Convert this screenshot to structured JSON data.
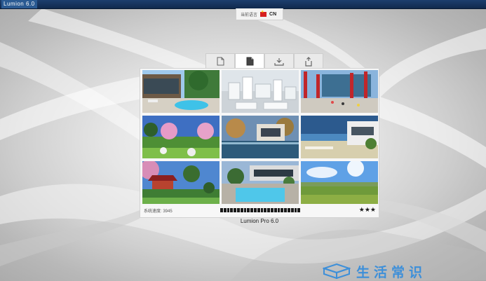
{
  "window": {
    "title": "Lumion 6.0"
  },
  "language": {
    "label": "当前语言",
    "code": "CN"
  },
  "tabs": [
    {
      "icon": "new-file-icon",
      "active": false
    },
    {
      "icon": "open-file-icon",
      "active": true
    },
    {
      "icon": "download-icon",
      "active": false
    },
    {
      "icon": "import-icon",
      "active": false
    }
  ],
  "gallery": [
    {
      "name": "modern-house-pool-scene"
    },
    {
      "name": "white-city-model-scene"
    },
    {
      "name": "red-pillars-plaza-scene"
    },
    {
      "name": "blossom-trees-river-scene"
    },
    {
      "name": "house-pond-autumn-scene"
    },
    {
      "name": "seaside-villa-scene"
    },
    {
      "name": "chinese-pavilion-garden-scene"
    },
    {
      "name": "resort-pool-evening-scene"
    },
    {
      "name": "meadow-sunny-landscape-scene"
    }
  ],
  "status": {
    "speed_label": "系统速度: 3945",
    "progress": 1.0,
    "rating": "★★★"
  },
  "version": "Lumion Pro 6.0",
  "watermark": {
    "text": "生活常识"
  }
}
